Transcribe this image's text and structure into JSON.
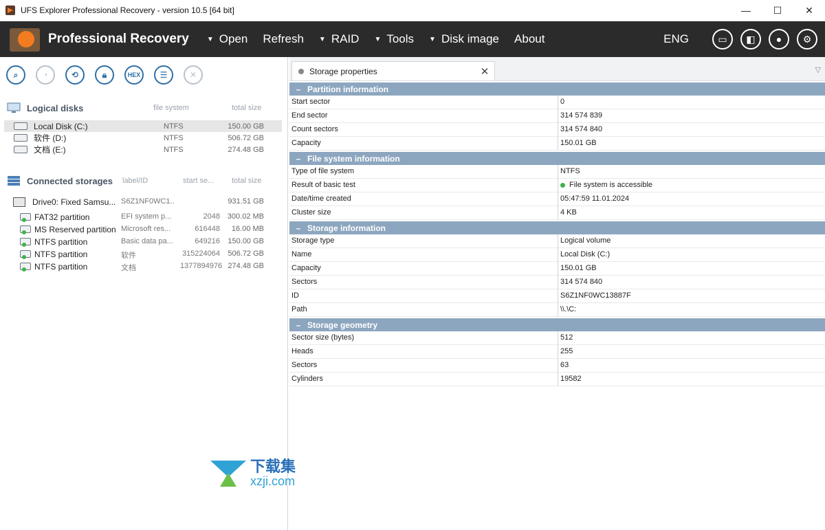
{
  "window": {
    "title": "UFS Explorer Professional Recovery - version 10.5 [64 bit]",
    "controls": [
      "—",
      "☐",
      "✕"
    ]
  },
  "menubar": {
    "brand": "Professional Recovery",
    "items": [
      {
        "label": "Open",
        "has_arrow": true
      },
      {
        "label": "Refresh",
        "has_arrow": false
      },
      {
        "label": "RAID",
        "has_arrow": true
      },
      {
        "label": "Tools",
        "has_arrow": true
      },
      {
        "label": "Disk image",
        "has_arrow": true
      },
      {
        "label": "About",
        "has_arrow": false
      }
    ],
    "language": "ENG",
    "right_icons": [
      "log-icon",
      "panel-icon",
      "user-icon",
      "settings-icon"
    ]
  },
  "left_toolbar": {
    "hex_label": "HEX",
    "buttons": [
      "search-icon",
      "chart-icon",
      "undelete-icon",
      "lock-icon",
      "hex-icon",
      "list-icon",
      "close-icon"
    ]
  },
  "logical_disks": {
    "title": "Logical disks",
    "col_fs": "file system",
    "col_size": "total size",
    "rows": [
      {
        "name": "Local Disk (C:)",
        "fs": "NTFS",
        "size": "150.00 GB",
        "selected": true
      },
      {
        "name": "软件 (D:)",
        "fs": "NTFS",
        "size": "506.72 GB",
        "selected": false
      },
      {
        "name": "文档 (E:)",
        "fs": "NTFS",
        "size": "274.48 GB",
        "selected": false
      }
    ]
  },
  "connected_storages": {
    "title": "Connected storages",
    "col_label": "label/ID",
    "col_start": "start se...",
    "col_size": "total size",
    "drive": {
      "name": "Drive0: Fixed Samsu...",
      "label": "S6Z1NF0WC1...",
      "start": "",
      "size": "931.51 GB"
    },
    "partitions": [
      {
        "name": "FAT32 partition",
        "label": "EFI system p...",
        "start": "2048",
        "size": "300.02 MB"
      },
      {
        "name": "MS Reserved partition",
        "label": "Microsoft res...",
        "start": "616448",
        "size": "16.00 MB"
      },
      {
        "name": "NTFS partition",
        "label": "Basic data pa...",
        "start": "649216",
        "size": "150.00 GB"
      },
      {
        "name": "NTFS partition",
        "label": "软件",
        "start": "315224064",
        "size": "506.72 GB"
      },
      {
        "name": "NTFS partition",
        "label": "文档",
        "start": "1377894976",
        "size": "274.48 GB"
      }
    ]
  },
  "tab": {
    "label": "Storage properties",
    "close": "✕",
    "menu": "▽"
  },
  "properties": {
    "sections": [
      {
        "title": "Partition information",
        "rows": [
          {
            "k": "Start sector",
            "v": "0"
          },
          {
            "k": "End sector",
            "v": "314 574 839"
          },
          {
            "k": "Count sectors",
            "v": "314 574 840"
          },
          {
            "k": "Capacity",
            "v": "150.01 GB"
          }
        ]
      },
      {
        "title": "File system information",
        "rows": [
          {
            "k": "Type of file system",
            "v": "NTFS"
          },
          {
            "k": "Result of basic test",
            "v": "File system is accessible",
            "status": "ok"
          },
          {
            "k": "Date/time created",
            "v": "05:47:59 11.01.2024"
          },
          {
            "k": "Cluster size",
            "v": "4 KB"
          }
        ]
      },
      {
        "title": "Storage information",
        "rows": [
          {
            "k": "Storage type",
            "v": "Logical volume"
          },
          {
            "k": "Name",
            "v": "Local Disk (C:)"
          },
          {
            "k": "Capacity",
            "v": "150.01 GB"
          },
          {
            "k": "Sectors",
            "v": "314 574 840"
          },
          {
            "k": "ID",
            "v": "S6Z1NF0WC13887F"
          },
          {
            "k": "Path",
            "v": "\\\\.\\C:"
          }
        ]
      },
      {
        "title": "Storage geometry",
        "rows": [
          {
            "k": "Sector size (bytes)",
            "v": "512"
          },
          {
            "k": "Heads",
            "v": "255"
          },
          {
            "k": "Sectors",
            "v": "63"
          },
          {
            "k": "Cylinders",
            "v": "19582"
          }
        ]
      }
    ]
  },
  "watermark": {
    "cn": "下载集",
    "en": "xzji.com"
  },
  "colors": {
    "menubar_bg": "#2b2b2b",
    "section_header": "#8da6bf",
    "accent_blue": "#2f6fa5",
    "status_ok": "#3db24a"
  }
}
